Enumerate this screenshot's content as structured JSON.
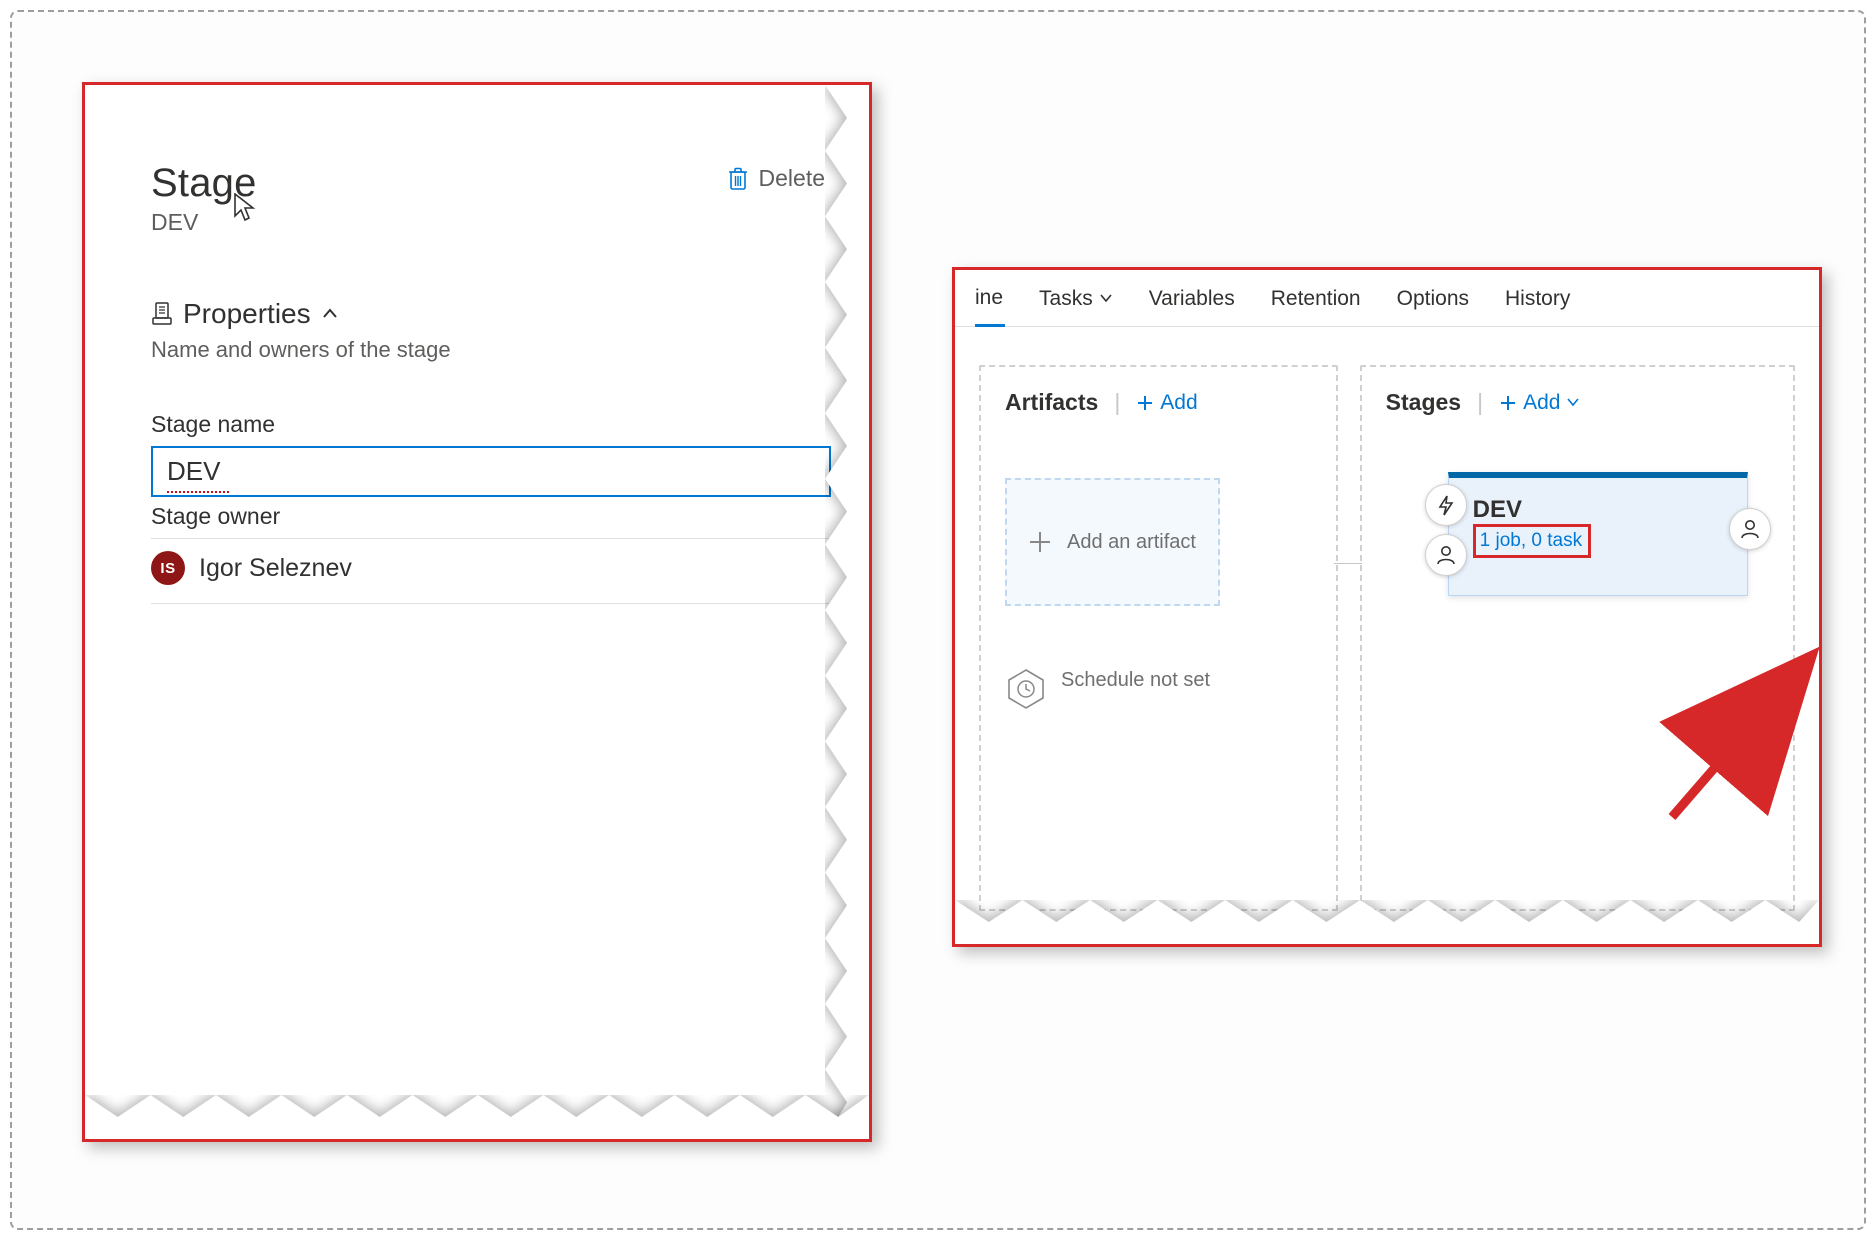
{
  "left_panel": {
    "title": "Stage",
    "subtitle": "DEV",
    "delete_label": "Delete",
    "properties_header": "Properties",
    "properties_subtitle": "Name and owners of the stage",
    "stage_name_label": "Stage name",
    "stage_name_value": "DEV",
    "stage_owner_label": "Stage owner",
    "owner_name": "Igor Seleznev",
    "owner_initials": "IS"
  },
  "right_panel": {
    "tabs": {
      "partial_first": "ine",
      "tasks": "Tasks",
      "variables": "Variables",
      "retention": "Retention",
      "options": "Options",
      "history": "History"
    },
    "artifacts": {
      "header": "Artifacts",
      "add_label": "Add",
      "add_card_label": "Add an artifact",
      "schedule_label": "Schedule not set"
    },
    "stages": {
      "header": "Stages",
      "add_label": "Add",
      "card_title": "DEV",
      "card_subtitle": "1 job, 0 task"
    }
  }
}
